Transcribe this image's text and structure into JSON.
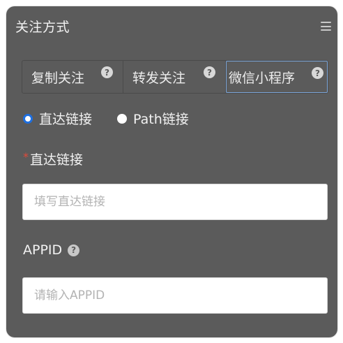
{
  "panel": {
    "title": "关注方式"
  },
  "tabs": [
    {
      "label": "复制关注",
      "help": "?"
    },
    {
      "label": "转发关注",
      "help": "?"
    },
    {
      "label": "微信小程序",
      "help": "?",
      "selected": true
    }
  ],
  "link_type": {
    "options": [
      {
        "label": "直达链接",
        "checked": true
      },
      {
        "label": "Path链接",
        "checked": false
      }
    ]
  },
  "direct_link": {
    "required_mark": "*",
    "label": "直达链接",
    "placeholder": "填写直达链接",
    "value": ""
  },
  "appid": {
    "label": "APPID",
    "help": "?",
    "placeholder": "请输入APPID",
    "value": ""
  },
  "colors": {
    "panel_bg": "#5b5b5b",
    "accent": "#1e6fe0",
    "selected_tab_border": "#7aa4d8",
    "required": "#e04a3a"
  }
}
